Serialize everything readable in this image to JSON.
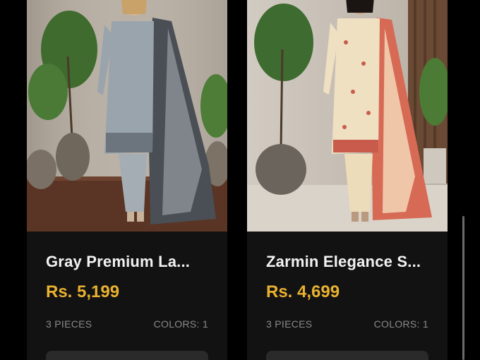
{
  "products": [
    {
      "name": "Gray Premium La...",
      "price": "Rs. 5,199",
      "pieces": "3 PIECES",
      "colors": "COLORS: 1",
      "image": "woman-gray-lawn-suit-photo"
    },
    {
      "name": "Zarmin Elegance S...",
      "price": "Rs. 4,699",
      "pieces": "3 PIECES",
      "colors": "COLORS: 1",
      "image": "woman-cream-floral-suit-photo"
    }
  ],
  "theme": {
    "background": "#000000",
    "card": "#121212",
    "price_color": "#e9b130",
    "text": "#f2f2f2",
    "meta": "#8a8a8a"
  }
}
